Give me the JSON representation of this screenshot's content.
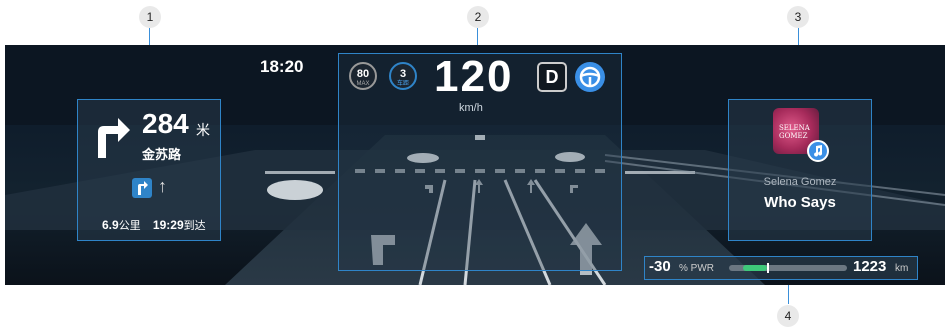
{
  "callouts": [
    "1",
    "2",
    "3",
    "4"
  ],
  "clock": "18:20",
  "navigation": {
    "distance": "284",
    "distance_unit": "米",
    "road": "金苏路",
    "remaining_distance": "6.9",
    "remaining_unit": "公里",
    "arrival_time": "19:29",
    "arrival_label": "到达"
  },
  "hud": {
    "speed_limit": "80",
    "speed_limit_label": "MAX",
    "following_gap": "3",
    "following_gap_label": "车距",
    "speed": "120",
    "speed_unit": "km/h",
    "gear": "D"
  },
  "music": {
    "album_text": "SELENA GOMEZ",
    "artist": "Selena Gomez",
    "title": "Who Says"
  },
  "status": {
    "power_value": "-30",
    "power_label": "% PWR",
    "power_fill_fraction": 0.2,
    "range_value": "1223",
    "range_unit": "km"
  },
  "colors": {
    "accent": "#2f84c8",
    "power_positive": "#3ec87a"
  }
}
